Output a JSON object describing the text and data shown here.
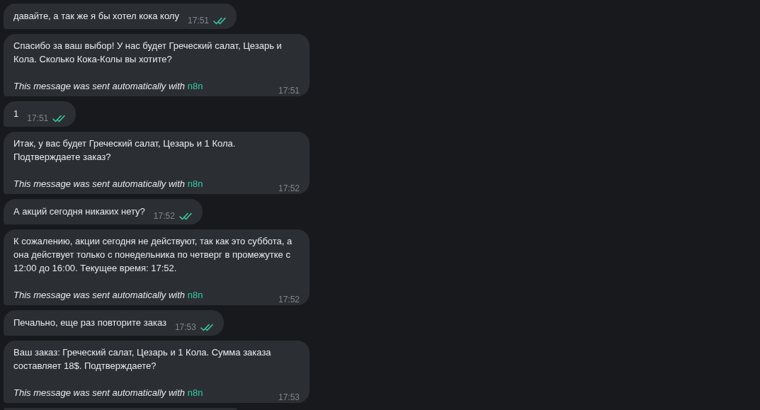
{
  "messages": [
    {
      "kind": "outgoing",
      "text": "давайте, а так же я бы хотел кока колу",
      "time": "17:51",
      "read": true
    },
    {
      "kind": "bot",
      "text": "Спасибо за ваш выбор! У нас будет Греческий салат, Цезарь и Кола. Сколько Кока-Колы вы хотите?",
      "footer": "This message was sent automatically with",
      "link": "n8n",
      "time": "17:51"
    },
    {
      "kind": "outgoing",
      "text": "1",
      "time": "17:51",
      "read": true
    },
    {
      "kind": "bot",
      "text": "Итак, у вас будет Греческий салат, Цезарь и 1 Кола. Подтверждаете заказ?",
      "footer": "This message was sent automatically with",
      "link": "n8n",
      "time": "17:52"
    },
    {
      "kind": "outgoing",
      "text": "А акций сегодня никаких нету?",
      "time": "17:52",
      "read": true
    },
    {
      "kind": "bot",
      "text": "К сожалению, акции сегодня не действуют, так как это суббота, а она действует только с понедельника по четверг в промежутке с 12:00 до 16:00. Текущее время: 17:52.",
      "footer": "This message was sent automatically with",
      "link": "n8n",
      "time": "17:52"
    },
    {
      "kind": "outgoing",
      "text": "Печально, еще раз повторите заказ",
      "time": "17:53",
      "read": true
    },
    {
      "kind": "bot",
      "text": "Ваш заказ: Греческий салат, Цезарь и 1 Кола. Сумма заказа составляет 18$. Подтверждаете?",
      "footer": "This message was sent automatically with",
      "link": "n8n",
      "time": "17:53"
    }
  ]
}
